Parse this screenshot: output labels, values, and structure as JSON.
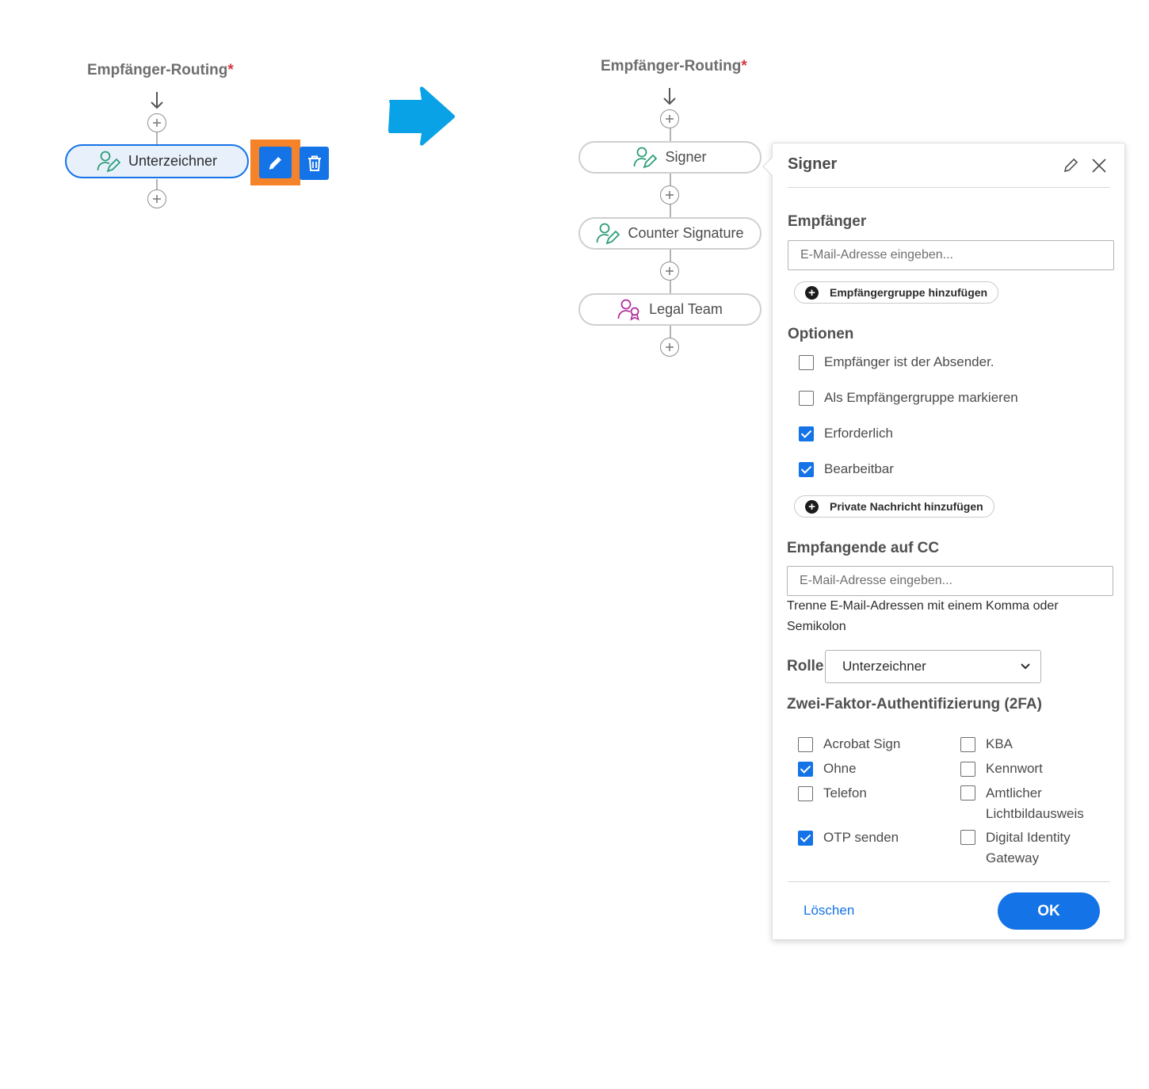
{
  "left": {
    "title": "Empfänger-Routing",
    "required_mark": "*",
    "recipient_label": "Unterzeichner"
  },
  "right": {
    "title": "Empfänger-Routing",
    "required_mark": "*",
    "recipients": [
      {
        "label": "Signer",
        "icon": "signer-icon"
      },
      {
        "label": "Counter Signature",
        "icon": "signer-icon"
      },
      {
        "label": "Legal Team",
        "icon": "approver-icon"
      }
    ]
  },
  "panel": {
    "title": "Signer",
    "recipient_section": "Empfänger",
    "email_placeholder": "E-Mail-Adresse eingeben...",
    "add_group_label": "Empfängergruppe hinzufügen",
    "options_section": "Optionen",
    "options": [
      {
        "label": "Empfänger ist der Absender.",
        "checked": false
      },
      {
        "label": "Als Empfängergruppe markieren",
        "checked": false
      },
      {
        "label": "Erforderlich",
        "checked": true
      },
      {
        "label": "Bearbeitbar",
        "checked": true
      }
    ],
    "private_message_label": "Private Nachricht hinzufügen",
    "cc_section": "Empfangende auf CC",
    "cc_placeholder": "E-Mail-Adresse eingeben...",
    "cc_hint": "Trenne E-Mail-Adressen mit einem Komma oder Semikolon",
    "role_label": "Rolle",
    "role_value": "Unterzeichner",
    "twofa_section": "Zwei-Faktor-Authentifizierung (2FA)",
    "twofa_left": [
      {
        "label": "Acrobat Sign",
        "checked": false
      },
      {
        "label": "Ohne",
        "checked": true
      },
      {
        "label": "Telefon",
        "checked": false
      },
      {
        "label": "OTP senden",
        "checked": true
      }
    ],
    "twofa_right": [
      {
        "label": "KBA",
        "checked": false
      },
      {
        "label": "Kennwort",
        "checked": false
      },
      {
        "label": "Amtlicher Lichtbildausweis",
        "checked": false
      },
      {
        "label": "Digital Identity Gateway",
        "checked": false
      }
    ],
    "delete_label": "Löschen",
    "ok_label": "OK"
  },
  "colors": {
    "accent": "#1473e6",
    "highlight": "#f5832a",
    "arrow": "#0aa2e6",
    "signer_icon": "#2d9d78",
    "approver_icon": "#b0319c"
  }
}
